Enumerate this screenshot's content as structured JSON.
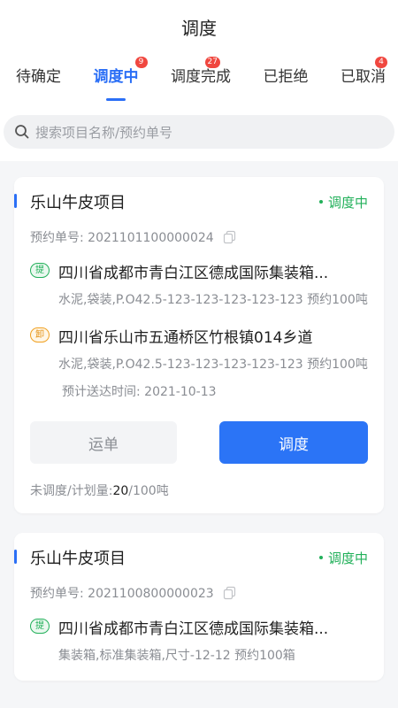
{
  "header": {
    "title": "调度"
  },
  "tabs": [
    {
      "label": "待确定",
      "badge": ""
    },
    {
      "label": "调度中",
      "badge": "9"
    },
    {
      "label": "调度完成",
      "badge": "27"
    },
    {
      "label": "已拒绝",
      "badge": ""
    },
    {
      "label": "已取消",
      "badge": "4"
    }
  ],
  "search": {
    "placeholder": "搜索项目名称/预约单号"
  },
  "cards": [
    {
      "title": "乐山牛皮项目",
      "status": "调度中",
      "order_no": "预约单号: 2021101100000024",
      "pickup": {
        "tag": "提",
        "address": "四川省成都市青白江区德成国际集装箱...",
        "goods": "水泥,袋装,P.O42.5-123-123-123-123-123   预约100吨"
      },
      "dropoff": {
        "tag": "卸",
        "address": "四川省乐山市五通桥区竹根镇014乡道",
        "goods": "水泥,袋装,P.O42.5-123-123-123-123-123   预约100吨"
      },
      "eta": "预计送达时间:   2021-10-13",
      "btn_waybill": "运单",
      "btn_dispatch": "调度",
      "progress_label": "未调度/计划量:",
      "progress_done": "20",
      "progress_total": "/100吨"
    },
    {
      "title": "乐山牛皮项目",
      "status": "调度中",
      "order_no": "预约单号: 2021100800000023",
      "pickup": {
        "tag": "提",
        "address": "四川省成都市青白江区德成国际集装箱...",
        "goods": "集装箱,标准集装箱,尺寸-12-12   预约100箱"
      }
    }
  ],
  "colors": {
    "accent": "#2b6ff6",
    "status_green": "#22b05a",
    "badge_red": "#f0473f",
    "drop_orange": "#f0a020"
  }
}
